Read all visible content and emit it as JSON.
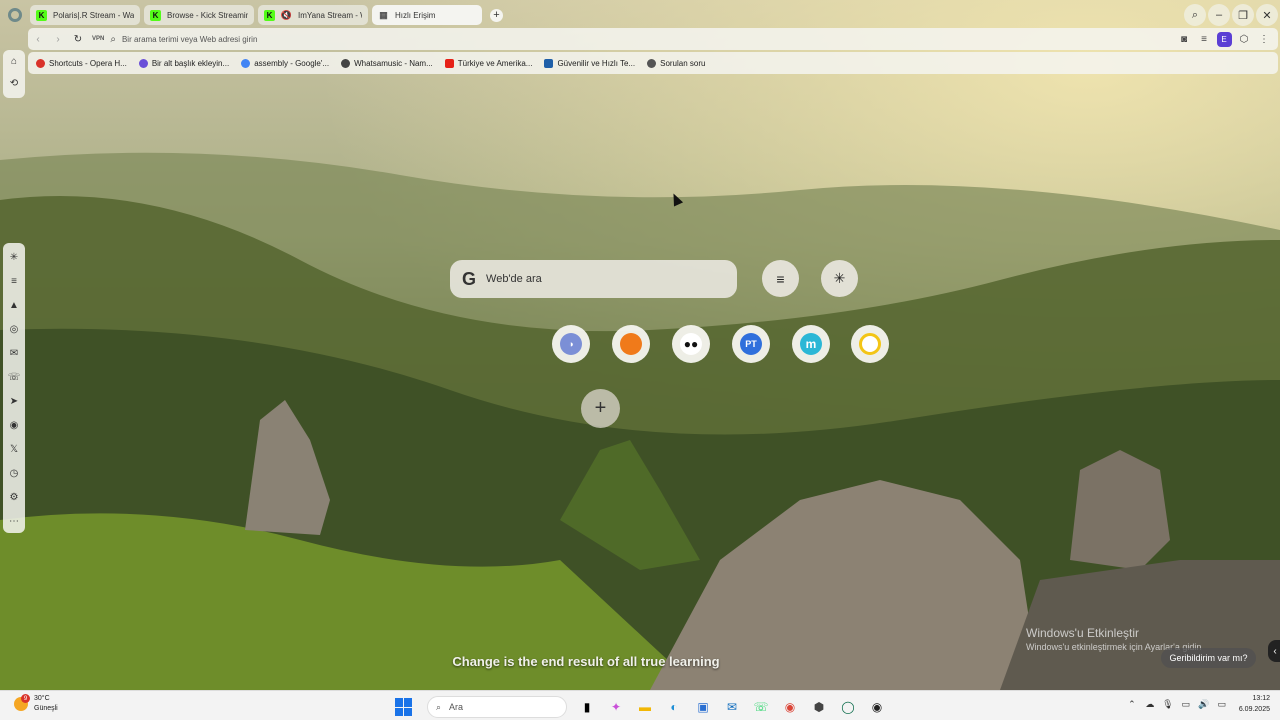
{
  "tabs": [
    {
      "label": "Polaris|.R Stream - Watch",
      "icon": "kick-logo"
    },
    {
      "label": "Browse - Kick Streaming",
      "icon": "kick-logo"
    },
    {
      "label": "ImYana Stream - W",
      "icon": "kick-logo"
    },
    {
      "label": "Hızlı Erişim",
      "icon": "grid-icon",
      "active": true
    }
  ],
  "address": {
    "vpn_label": "VPN",
    "placeholder": "Bir arama terimi veya Web adresi girin",
    "profile_initial": "E"
  },
  "bookmarks": [
    {
      "label": "Shortcuts - Opera H...",
      "color": "#d9322a"
    },
    {
      "label": "Bir alt başlık ekleyin...",
      "color": "#6a4fd8"
    },
    {
      "label": "assembly - Google'...",
      "color": "#4285f4"
    },
    {
      "label": "Whatsamusic - Nam...",
      "color": "#444444"
    },
    {
      "label": "Türkiye ve Amerika...",
      "color": "#e62117"
    },
    {
      "label": "Güvenilir ve Hızlı Te...",
      "color": "#1f5fa8"
    },
    {
      "label": "Sorulan soru",
      "color": "#555555"
    }
  ],
  "search": {
    "placeholder": "Web'de ara",
    "logo": "G"
  },
  "speed_dials": [
    {
      "name": "dial-1",
      "color": "#7b8fd6",
      "glyph": ""
    },
    {
      "name": "dial-2",
      "color": "#f07a1a",
      "glyph": ""
    },
    {
      "name": "dial-3",
      "color": "#111111",
      "glyph": "●●"
    },
    {
      "name": "dial-4",
      "color": "#2f6fdc",
      "glyph": "PT"
    },
    {
      "name": "dial-5",
      "color": "#2bb7d6",
      "glyph": "m"
    },
    {
      "name": "dial-6",
      "color": "#f3c516",
      "glyph": ""
    }
  ],
  "quote": "Change is the end result of all true learning",
  "windows_activation": {
    "title": "Windows'u Etkinleştir",
    "subtitle": "Windows'u etkinleştirmek için Ayarlar'a gidin"
  },
  "feedback_label": "Geribildirim var mı?",
  "taskbar": {
    "weather_temp": "30°C",
    "weather_desc": "Güneşli",
    "weather_badge": "9",
    "search_placeholder": "Ara",
    "time": "13:12",
    "date": "6.09.2025"
  }
}
